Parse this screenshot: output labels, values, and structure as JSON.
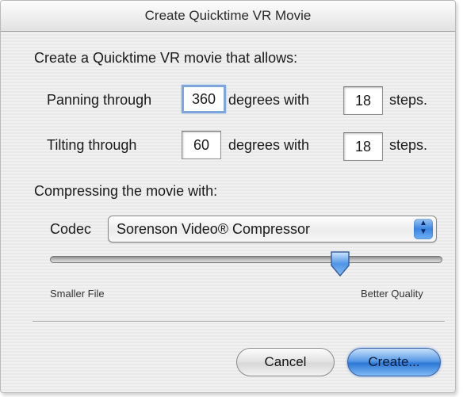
{
  "dialog": {
    "title": "Create Quicktime VR Movie",
    "intro": "Create a Quicktime VR movie that allows:",
    "panning": {
      "label": "Panning through",
      "degrees": "360",
      "degrees_label": "degrees with",
      "steps": "18",
      "steps_label": "steps."
    },
    "tilting": {
      "label": "Tilting through",
      "degrees": "60",
      "degrees_label": "degrees with",
      "steps": "18",
      "steps_label": "steps."
    },
    "compress_label": "Compressing the movie with:",
    "codec": {
      "label": "Codec",
      "selected": "Sorenson Video® Compressor"
    },
    "quality": {
      "min_label": "Smaller File",
      "max_label": "Better Quality",
      "value": 0.74
    },
    "buttons": {
      "cancel": "Cancel",
      "create": "Create..."
    }
  },
  "colors": {
    "accent": "#3d86e2",
    "focus_ring": "#7fa6dc"
  },
  "icons": {
    "codec_select": "updown-arrows-icon",
    "slider": "slider-thumb-icon"
  }
}
